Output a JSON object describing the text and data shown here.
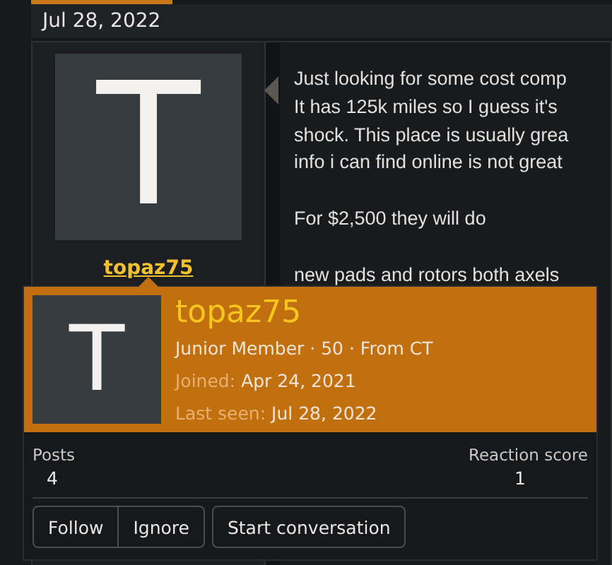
{
  "post": {
    "date": "Jul 28, 2022",
    "author": {
      "avatar_letter": "T",
      "username": "topaz75"
    },
    "message_paragraphs": [
      [
        "Just looking for some cost comp",
        "It has 125k miles so I guess it's",
        "shock. This place is usually grea",
        "info i can find online is not great"
      ],
      [
        "For $2,500 they will do"
      ],
      [
        "new pads and rotors both axels"
      ]
    ]
  },
  "popup": {
    "avatar_letter": "T",
    "username": "topaz75",
    "summary": "Junior Member · 50 · From CT",
    "facts": [
      {
        "label": "Joined:",
        "value": "Apr 24, 2021"
      },
      {
        "label": "Last seen:",
        "value": "Jul 28, 2022"
      }
    ],
    "stats": [
      {
        "label": "Posts",
        "value": "4"
      },
      {
        "label": "Reaction score",
        "value": "1"
      }
    ],
    "button_group": [
      "Follow",
      "Ignore"
    ],
    "buttons": [
      "Start conversation"
    ]
  }
}
